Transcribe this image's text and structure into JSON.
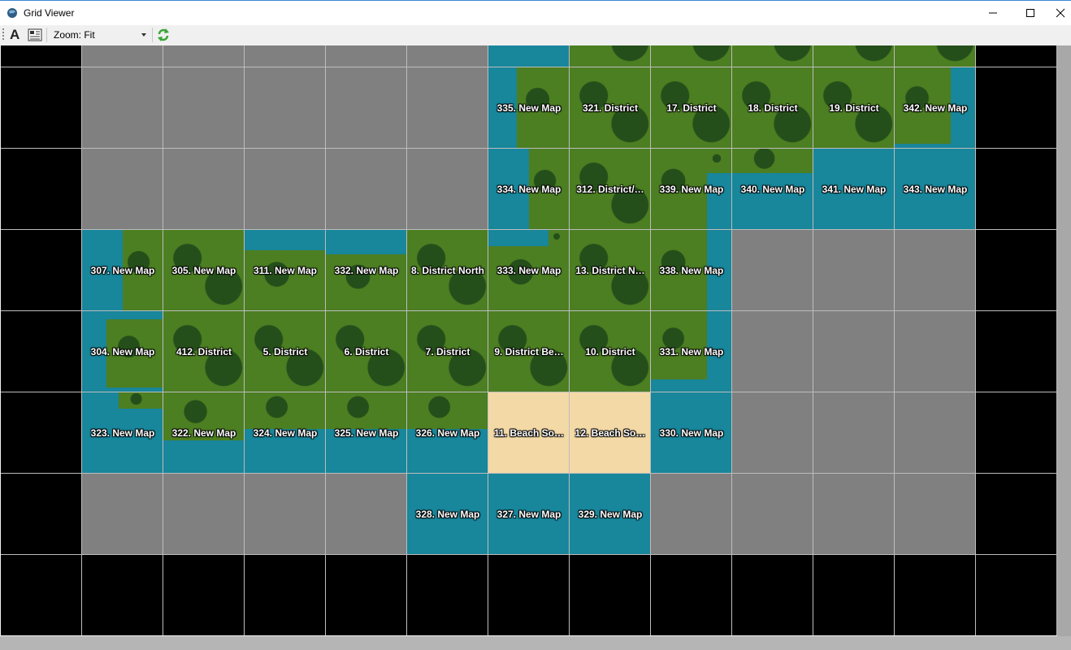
{
  "window": {
    "title": "Grid Viewer",
    "controls": [
      "minimize",
      "maximize",
      "close"
    ]
  },
  "toolbar": {
    "font_icon_glyph": "A",
    "zoom_label": "Zoom: Fit",
    "icons": [
      "font-icon",
      "grid-view-icon",
      "chevron-down-icon",
      "refresh-icon"
    ]
  },
  "colors": {
    "gray": "#808080",
    "black": "#000000",
    "water": "#18869b",
    "grass": "#4c7e22",
    "forest": "#254f1a",
    "sand": "#f3d9a6",
    "gridline": "#bdbdbd"
  },
  "grid": {
    "rows": [
      [
        {
          "type": "black",
          "label": ""
        },
        {
          "type": "gray",
          "label": ""
        },
        {
          "type": "gray",
          "label": ""
        },
        {
          "type": "gray",
          "label": ""
        },
        {
          "type": "gray",
          "label": ""
        },
        {
          "type": "gray",
          "label": ""
        },
        {
          "type": "map",
          "bg": "water",
          "terrain": [
            [
              0.3,
              1,
              0,
              0.6
            ]
          ],
          "label": ""
        },
        {
          "type": "map",
          "bg": "grass",
          "terrain": [],
          "label": ""
        },
        {
          "type": "map",
          "bg": "grass",
          "terrain": [],
          "label": ""
        },
        {
          "type": "map",
          "bg": "grass",
          "terrain": [],
          "label": ""
        },
        {
          "type": "map",
          "bg": "grass",
          "terrain": [],
          "label": ""
        },
        {
          "type": "map",
          "bg": "grass",
          "terrain": [],
          "label": ""
        },
        {
          "type": "black",
          "label": ""
        }
      ],
      [
        {
          "type": "black",
          "label": ""
        },
        {
          "type": "gray",
          "label": ""
        },
        {
          "type": "gray",
          "label": ""
        },
        {
          "type": "gray",
          "label": ""
        },
        {
          "type": "gray",
          "label": ""
        },
        {
          "type": "gray",
          "label": ""
        },
        {
          "type": "map",
          "bg": "water",
          "terrain": [
            [
              0.35,
              1,
              0,
              1
            ]
          ],
          "label": "335. New Map"
        },
        {
          "type": "map",
          "bg": "grass",
          "terrain": [],
          "label": "321. District"
        },
        {
          "type": "map",
          "bg": "grass",
          "terrain": [],
          "label": "17. District"
        },
        {
          "type": "map",
          "bg": "grass",
          "terrain": [],
          "label": "18. District"
        },
        {
          "type": "map",
          "bg": "grass",
          "terrain": [],
          "label": "19. District"
        },
        {
          "type": "map",
          "bg": "water",
          "terrain": [
            [
              0,
              0.7,
              0,
              0.95
            ]
          ],
          "label": "342. New Map"
        },
        {
          "type": "black",
          "label": ""
        }
      ],
      [
        {
          "type": "black",
          "label": ""
        },
        {
          "type": "gray",
          "label": ""
        },
        {
          "type": "gray",
          "label": ""
        },
        {
          "type": "gray",
          "label": ""
        },
        {
          "type": "gray",
          "label": ""
        },
        {
          "type": "gray",
          "label": ""
        },
        {
          "type": "map",
          "bg": "water",
          "terrain": [
            [
              0.5,
              1,
              0,
              1
            ]
          ],
          "label": "334. New Map"
        },
        {
          "type": "map",
          "bg": "grass",
          "terrain": [],
          "label": "312. District/…"
        },
        {
          "type": "map",
          "bg": "water",
          "terrain": [
            [
              0,
              0.7,
              0,
              1
            ],
            [
              0.7,
              1,
              0,
              0.3
            ]
          ],
          "label": "339. New Map"
        },
        {
          "type": "map",
          "bg": "water",
          "terrain": [
            [
              0,
              1,
              0,
              0.3
            ]
          ],
          "label": "340. New Map"
        },
        {
          "type": "map",
          "bg": "water",
          "terrain": [],
          "label": "341. New Map"
        },
        {
          "type": "map",
          "bg": "water",
          "terrain": [],
          "label": "343. New Map"
        },
        {
          "type": "black",
          "label": ""
        }
      ],
      [
        {
          "type": "black",
          "label": ""
        },
        {
          "type": "map",
          "bg": "water",
          "terrain": [
            [
              0.5,
              1,
              0,
              1
            ]
          ],
          "label": "307. New Map"
        },
        {
          "type": "map",
          "bg": "grass",
          "terrain": [],
          "label": "305. New Map"
        },
        {
          "type": "map",
          "bg": "water",
          "terrain": [
            [
              0,
              1,
              0.25,
              1
            ]
          ],
          "label": "311. New Map"
        },
        {
          "type": "map",
          "bg": "water",
          "terrain": [
            [
              0,
              1,
              0.3,
              1
            ]
          ],
          "label": "332. New Map"
        },
        {
          "type": "map",
          "bg": "grass",
          "terrain": [],
          "label": "8. District North"
        },
        {
          "type": "map",
          "bg": "water",
          "terrain": [
            [
              0,
              1,
              0.2,
              1
            ],
            [
              0.75,
              1,
              0,
              0.2
            ]
          ],
          "label": "333. New Map"
        },
        {
          "type": "map",
          "bg": "grass",
          "terrain": [],
          "label": "13. District N…"
        },
        {
          "type": "map",
          "bg": "water",
          "terrain": [
            [
              0,
              0.7,
              0,
              1
            ]
          ],
          "label": "338. New Map"
        },
        {
          "type": "gray",
          "label": ""
        },
        {
          "type": "gray",
          "label": ""
        },
        {
          "type": "gray",
          "label": ""
        },
        {
          "type": "black",
          "label": ""
        }
      ],
      [
        {
          "type": "black",
          "label": ""
        },
        {
          "type": "map",
          "bg": "water",
          "terrain": [
            [
              0.3,
              1,
              0.1,
              0.95
            ]
          ],
          "label": "304. New Map"
        },
        {
          "type": "map",
          "bg": "grass",
          "terrain": [],
          "label": "412. District"
        },
        {
          "type": "map",
          "bg": "grass",
          "terrain": [],
          "label": "5. District"
        },
        {
          "type": "map",
          "bg": "grass",
          "terrain": [],
          "label": "6. District"
        },
        {
          "type": "map",
          "bg": "grass",
          "terrain": [],
          "label": "7. District"
        },
        {
          "type": "map",
          "bg": "grass",
          "terrain": [],
          "label": "9. District Be…"
        },
        {
          "type": "map",
          "bg": "grass",
          "terrain": [],
          "label": "10. District"
        },
        {
          "type": "map",
          "bg": "water",
          "terrain": [
            [
              0,
              0.7,
              0,
              0.85
            ]
          ],
          "label": "331. New Map"
        },
        {
          "type": "gray",
          "label": ""
        },
        {
          "type": "gray",
          "label": ""
        },
        {
          "type": "gray",
          "label": ""
        },
        {
          "type": "black",
          "label": ""
        }
      ],
      [
        {
          "type": "black",
          "label": ""
        },
        {
          "type": "map",
          "bg": "water",
          "terrain": [
            [
              0.45,
              1,
              0,
              0.2
            ]
          ],
          "label": "323. New Map"
        },
        {
          "type": "map",
          "bg": "water",
          "terrain": [
            [
              0,
              1,
              0,
              0.6
            ]
          ],
          "label": "322. New Map"
        },
        {
          "type": "map",
          "bg": "water",
          "terrain": [
            [
              0,
              1,
              0,
              0.45
            ]
          ],
          "label": "324. New Map"
        },
        {
          "type": "map",
          "bg": "water",
          "terrain": [
            [
              0,
              1,
              0,
              0.45
            ]
          ],
          "label": "325. New Map"
        },
        {
          "type": "map",
          "bg": "water",
          "terrain": [
            [
              0,
              1,
              0,
              0.45
            ]
          ],
          "label": "326. New Map"
        },
        {
          "type": "map",
          "bg": "sand",
          "terrain": [],
          "label": "11. Beach So…"
        },
        {
          "type": "map",
          "bg": "sand",
          "terrain": [],
          "label": "12. Beach So…"
        },
        {
          "type": "map",
          "bg": "water",
          "terrain": [],
          "label": "330. New Map"
        },
        {
          "type": "gray",
          "label": ""
        },
        {
          "type": "gray",
          "label": ""
        },
        {
          "type": "gray",
          "label": ""
        },
        {
          "type": "black",
          "label": ""
        }
      ],
      [
        {
          "type": "black",
          "label": ""
        },
        {
          "type": "gray",
          "label": ""
        },
        {
          "type": "gray",
          "label": ""
        },
        {
          "type": "gray",
          "label": ""
        },
        {
          "type": "gray",
          "label": ""
        },
        {
          "type": "map",
          "bg": "water",
          "terrain": [],
          "label": "328. New Map"
        },
        {
          "type": "map",
          "bg": "water",
          "terrain": [],
          "label": "327. New Map"
        },
        {
          "type": "map",
          "bg": "water",
          "terrain": [],
          "label": "329. New Map"
        },
        {
          "type": "gray",
          "label": ""
        },
        {
          "type": "gray",
          "label": ""
        },
        {
          "type": "gray",
          "label": ""
        },
        {
          "type": "gray",
          "label": ""
        },
        {
          "type": "black",
          "label": ""
        }
      ],
      [
        {
          "type": "black",
          "label": ""
        },
        {
          "type": "black",
          "label": ""
        },
        {
          "type": "black",
          "label": ""
        },
        {
          "type": "black",
          "label": ""
        },
        {
          "type": "black",
          "label": ""
        },
        {
          "type": "black",
          "label": ""
        },
        {
          "type": "black",
          "label": ""
        },
        {
          "type": "black",
          "label": ""
        },
        {
          "type": "black",
          "label": ""
        },
        {
          "type": "black",
          "label": ""
        },
        {
          "type": "black",
          "label": ""
        },
        {
          "type": "black",
          "label": ""
        },
        {
          "type": "black",
          "label": ""
        }
      ]
    ]
  }
}
